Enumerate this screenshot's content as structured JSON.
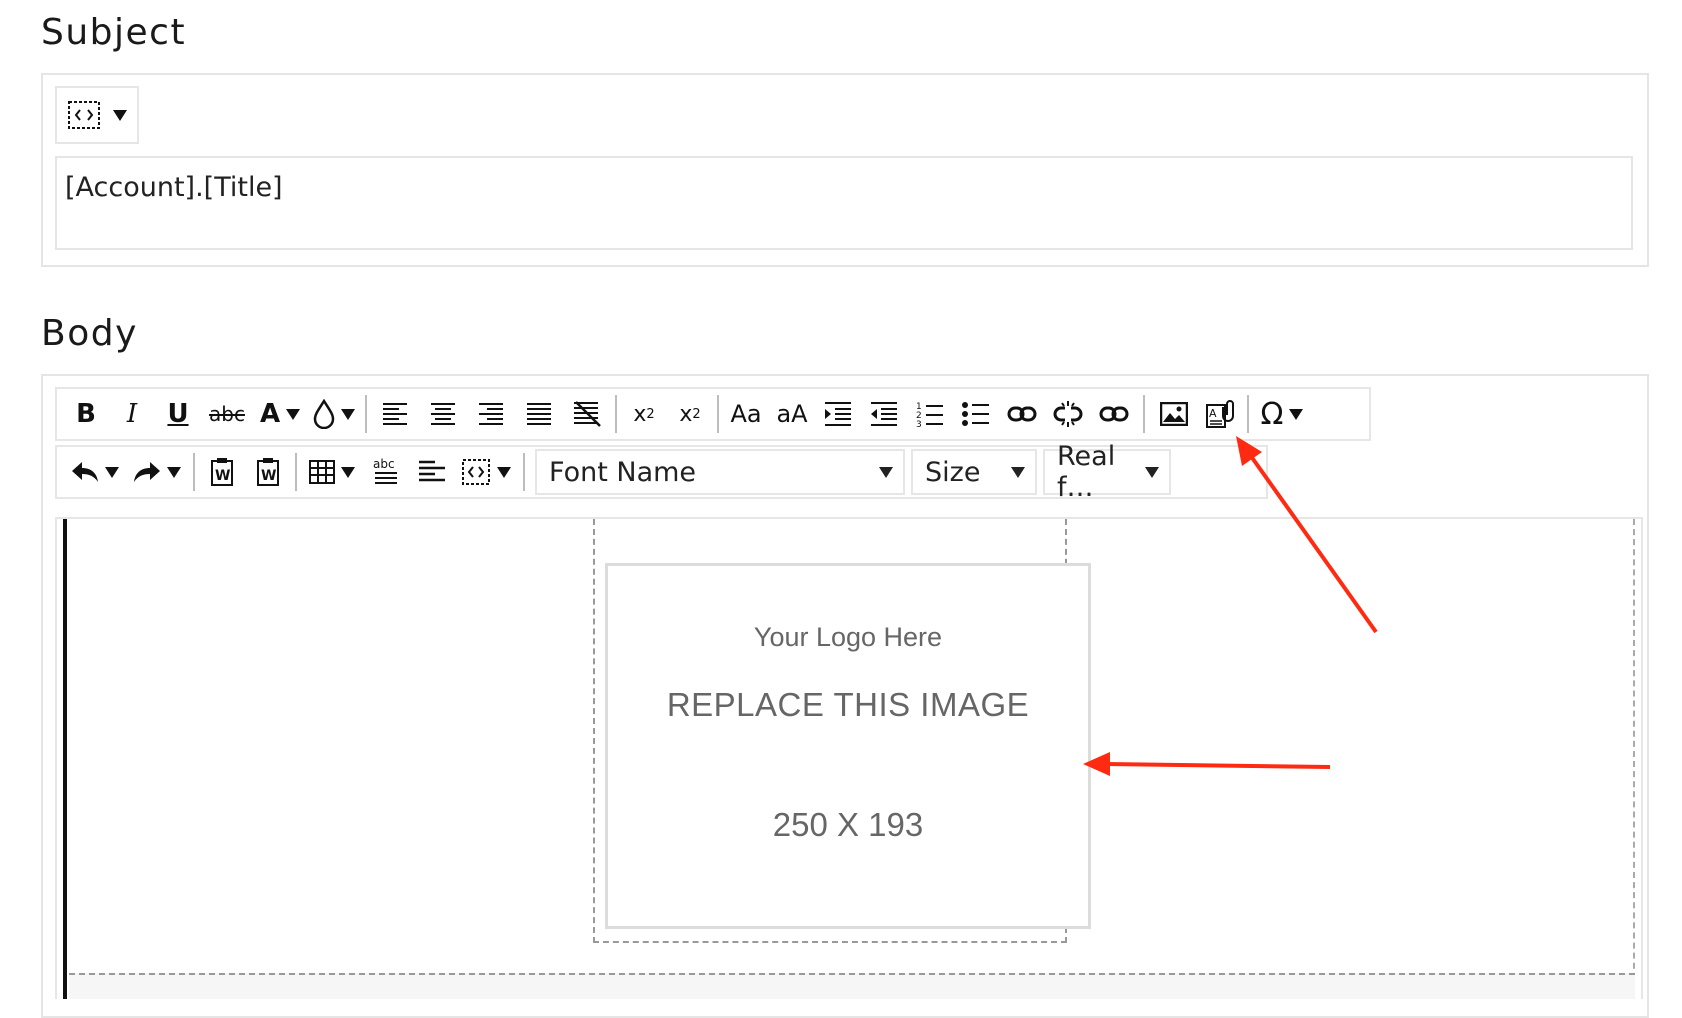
{
  "subject": {
    "label": "Subject",
    "value": "[Account].[Title]",
    "tool_icon": "source-code-icon"
  },
  "body": {
    "label": "Body",
    "toolbar_row1": [
      {
        "name": "bold-button",
        "glyph": "B"
      },
      {
        "name": "italic-button",
        "glyph": "I"
      },
      {
        "name": "underline-button",
        "glyph": "U"
      },
      {
        "name": "strikethrough-button",
        "glyph": "abc"
      },
      {
        "name": "font-color-button",
        "glyph": "A"
      },
      {
        "name": "highlight-color-button",
        "glyph": "drop"
      },
      {
        "name": "align-left-button",
        "glyph": "align-left"
      },
      {
        "name": "align-center-button",
        "glyph": "align-center"
      },
      {
        "name": "align-right-button",
        "glyph": "align-right"
      },
      {
        "name": "justify-button",
        "glyph": "justify"
      },
      {
        "name": "clear-formatting-button",
        "glyph": "clear-format"
      },
      {
        "name": "superscript-button",
        "glyph": "x²"
      },
      {
        "name": "subscript-button",
        "glyph": "x₂"
      },
      {
        "name": "uppercase-button",
        "glyph": "Aa"
      },
      {
        "name": "lowercase-button",
        "glyph": "aA"
      },
      {
        "name": "indent-button",
        "glyph": "indent"
      },
      {
        "name": "outdent-button",
        "glyph": "outdent"
      },
      {
        "name": "numbered-list-button",
        "glyph": "ol"
      },
      {
        "name": "bullet-list-button",
        "glyph": "ul"
      },
      {
        "name": "insert-link-button",
        "glyph": "link"
      },
      {
        "name": "unlink-button",
        "glyph": "unlink"
      },
      {
        "name": "link-manager-button",
        "glyph": "link"
      },
      {
        "name": "insert-image-button",
        "glyph": "image"
      },
      {
        "name": "document-manager-button",
        "glyph": "doc"
      },
      {
        "name": "special-chars-button",
        "glyph": "Ω"
      }
    ],
    "font_name": "Font Name",
    "font_size": "Size",
    "real_font_size": "Real f…",
    "placeholder_image": {
      "line1": "Your Logo Here",
      "line2": "REPLACE THIS IMAGE",
      "line3": "250 X 193"
    }
  },
  "colors": {
    "annotation_arrow": "#ff2a12",
    "border": "#e5e5e5"
  }
}
